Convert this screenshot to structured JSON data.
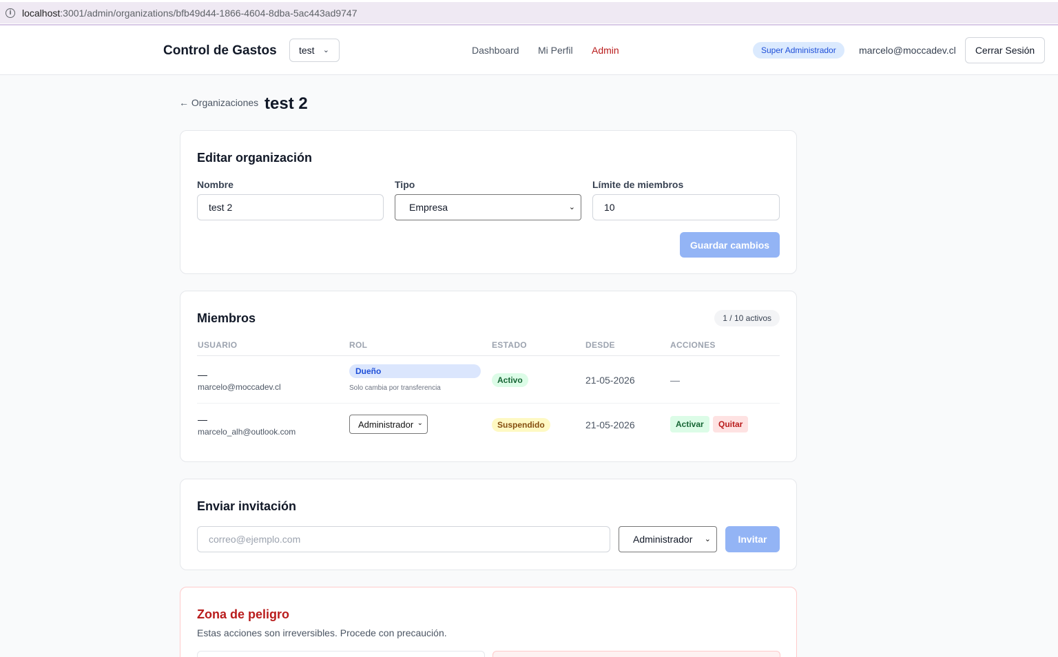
{
  "browser": {
    "url_host": "localhost",
    "url_path": ":3001/admin/organizations/bfb49d44-1866-4604-8dba-5ac443ad9747"
  },
  "header": {
    "brand": "Control de Gastos",
    "org_selector": "test",
    "nav": [
      "Dashboard",
      "Mi Perfil",
      "Admin"
    ],
    "role_badge": "Super Administrador",
    "user_email": "marcelo@moccadev.cl",
    "logout_label": "Cerrar Sesión"
  },
  "page": {
    "back_link": "← Organizaciones",
    "title": "test 2"
  },
  "edit_org": {
    "title": "Editar organización",
    "name_label": "Nombre",
    "name_value": "test 2",
    "type_label": "Tipo",
    "type_value": "Empresa",
    "limit_label": "Límite de miembros",
    "limit_value": "10",
    "save_label": "Guardar cambios"
  },
  "members": {
    "title": "Miembros",
    "count": "1 / 10 activos",
    "columns": [
      "USUARIO",
      "ROL",
      "ESTADO",
      "DESDE",
      "ACCIONES"
    ],
    "rows": [
      {
        "name": "—",
        "email": "marcelo@moccadev.cl",
        "role": "Dueño",
        "role_note": "Solo cambia por transferencia",
        "status": "Activo",
        "since": "21-05-2026",
        "actions": "—"
      },
      {
        "name": "—",
        "email": "marcelo_alh@outlook.com",
        "role": "Administrador",
        "status": "Suspendido",
        "since": "21-05-2026",
        "action_activate": "Activar",
        "action_remove": "Quitar"
      }
    ]
  },
  "invite": {
    "title": "Enviar invitación",
    "email_placeholder": "correo@ejemplo.com",
    "role_value": "Administrador",
    "invite_label": "Invitar"
  },
  "danger": {
    "title": "Zona de peligro",
    "description": "Estas acciones son irreversibles. Procede con precaución."
  },
  "colors": {
    "accent": "#b91c1c",
    "primary_button": "#93b4f5",
    "badge_blue": "#dbeafe"
  }
}
